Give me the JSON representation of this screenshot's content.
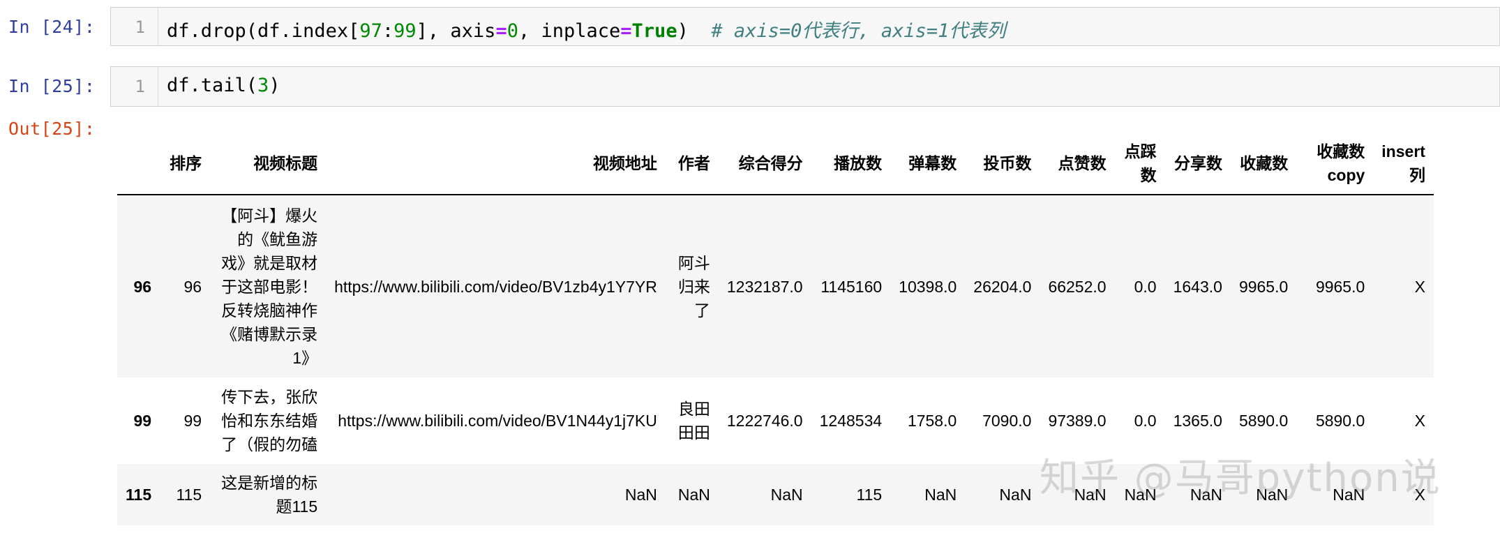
{
  "cells": [
    {
      "prompt": "In [24]:",
      "line_number": "1",
      "code": {
        "p1": "df.drop(df.index[",
        "n1": "97",
        "op1": ":",
        "n2": "99",
        "p2": "], axis",
        "op2": "=",
        "n3": "0",
        "p3": ", inplace",
        "op3": "=",
        "kw1": "True",
        "p4": ")  ",
        "comment": "# axis=0代表行, axis=1代表列"
      }
    },
    {
      "prompt": "In [25]:",
      "line_number": "1",
      "code": {
        "p1": "df.tail(",
        "n1": "3",
        "p2": ")"
      }
    }
  ],
  "output": {
    "prompt": "Out[25]:",
    "columns": [
      "排序",
      "视频标题",
      "视频地址",
      "作者",
      "综合得分",
      "播放数",
      "弹幕数",
      "投币数",
      "点赞数",
      "点踩数",
      "分享数",
      "收藏数",
      "收藏数copy",
      "insert列"
    ],
    "rows": [
      {
        "index": "96",
        "cells": [
          "96",
          "【阿斗】爆火的《鱿鱼游戏》就是取材于这部电影！反转烧脑神作《赌博默示录1》",
          "https://www.bilibili.com/video/BV1zb4y1Y7YR",
          "阿斗归来了",
          "1232187.0",
          "1145160",
          "10398.0",
          "26204.0",
          "66252.0",
          "0.0",
          "1643.0",
          "9965.0",
          "9965.0",
          "X"
        ]
      },
      {
        "index": "99",
        "cells": [
          "99",
          "传下去，张欣怡和东东结婚了（假的勿磕",
          "https://www.bilibili.com/video/BV1N44y1j7KU",
          "良田田田",
          "1222746.0",
          "1248534",
          "1758.0",
          "7090.0",
          "97389.0",
          "0.0",
          "1365.0",
          "5890.0",
          "5890.0",
          "X"
        ]
      },
      {
        "index": "115",
        "cells": [
          "115",
          "这是新增的标题115",
          "NaN",
          "NaN",
          "NaN",
          "115",
          "NaN",
          "NaN",
          "NaN",
          "NaN",
          "NaN",
          "NaN",
          "NaN",
          "X"
        ]
      }
    ]
  },
  "watermark": "知乎 @马哥python说"
}
